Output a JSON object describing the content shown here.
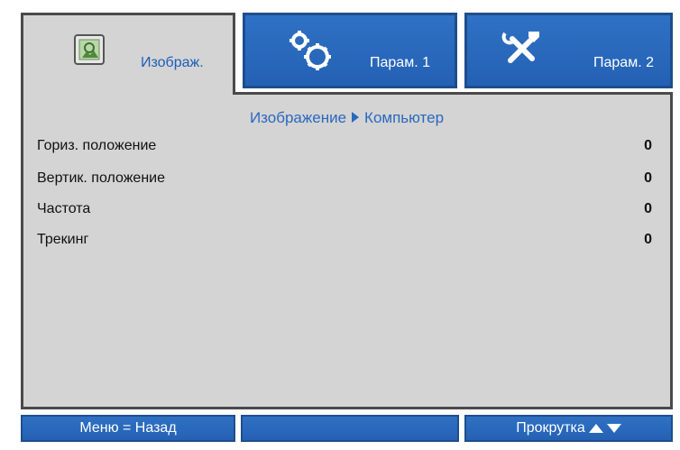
{
  "tabs": [
    {
      "label": "Изображ.",
      "icon": "image-settings-icon",
      "active": true
    },
    {
      "label": "Парам. 1",
      "icon": "gears-icon",
      "active": false
    },
    {
      "label": "Парам. 2",
      "icon": "tools-icon",
      "active": false
    }
  ],
  "breadcrumb": {
    "section": "Изображение",
    "page": "Компьютер"
  },
  "settings": [
    {
      "label": "Гориз. положение",
      "value": "0"
    },
    {
      "label": "Вертик. положение",
      "value": "0"
    },
    {
      "label": "Частота",
      "value": "0"
    },
    {
      "label": "Трекинг",
      "value": "0"
    }
  ],
  "footer": {
    "back": "Меню = Назад",
    "middle": "",
    "scroll": "Прокрутка"
  },
  "colors": {
    "accent": "#2a68bf",
    "panel": "#d4d4d4",
    "border": "#4a4a4a",
    "button": "#2666b9"
  }
}
